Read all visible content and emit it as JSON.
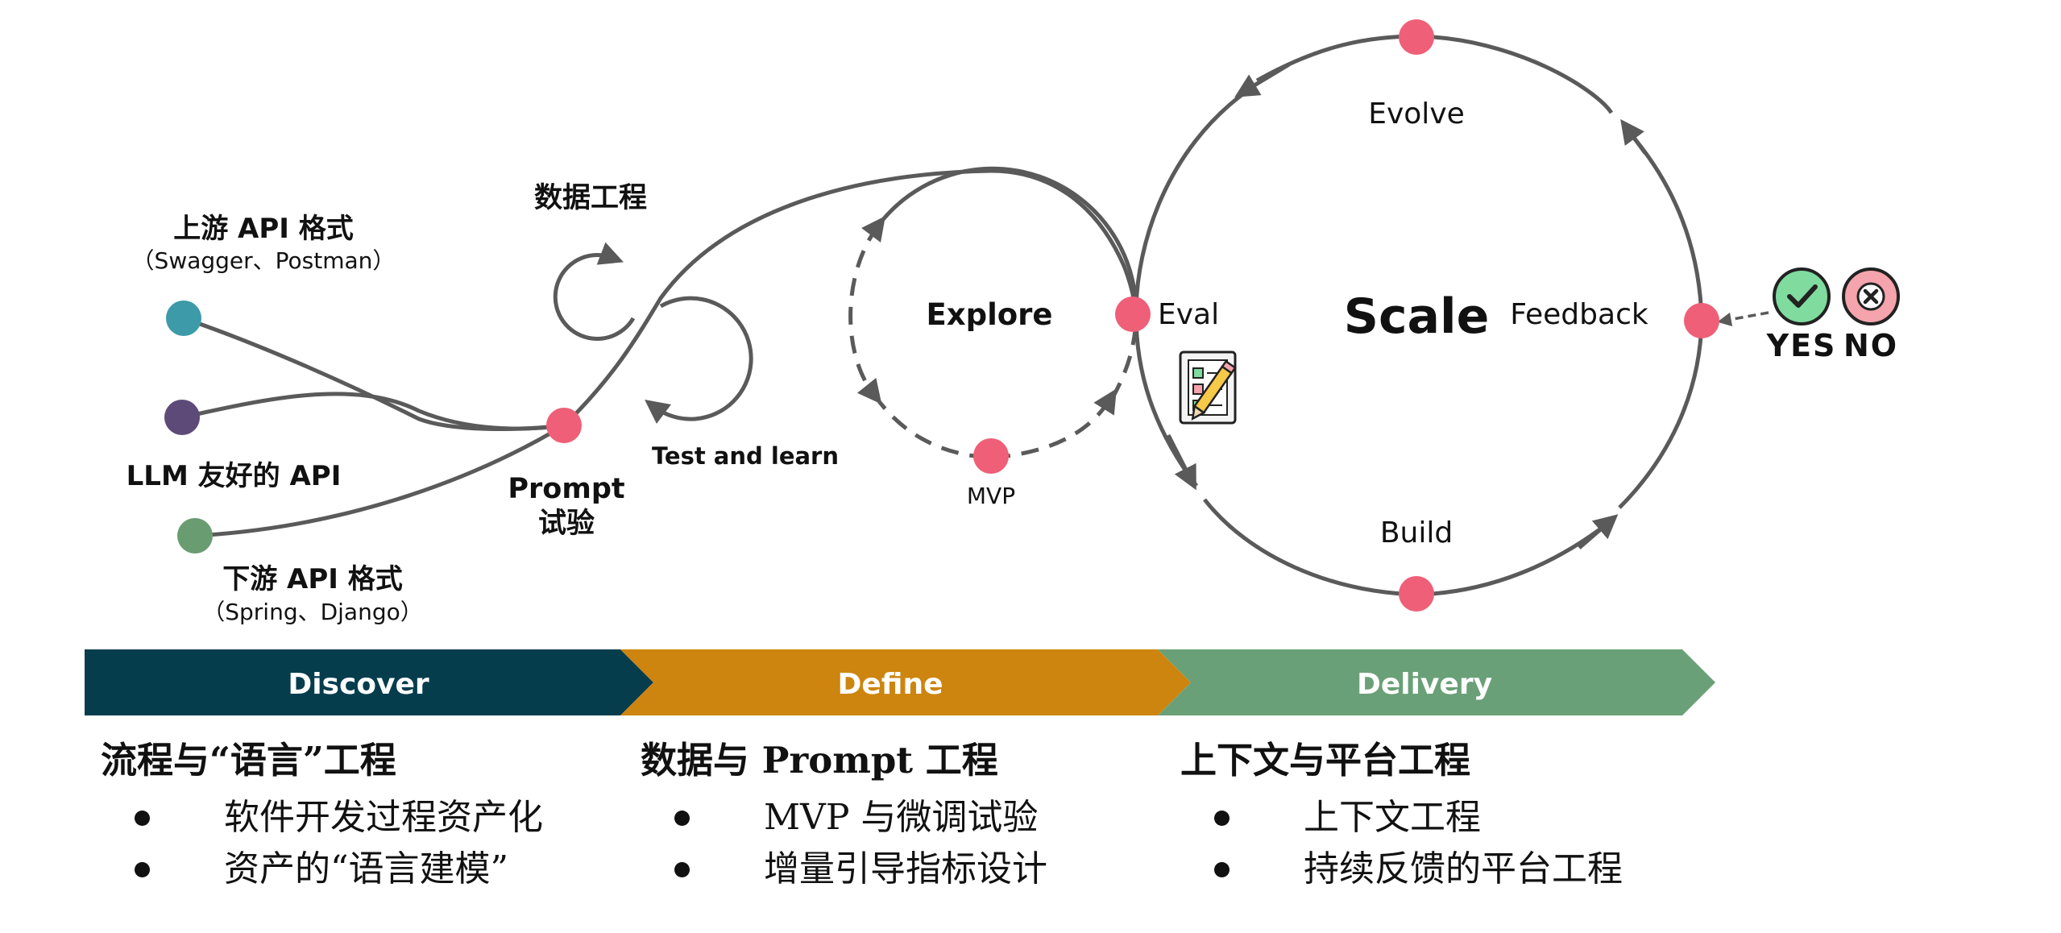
{
  "colors": {
    "node": "#ef5f78",
    "line": "#5a5a5a",
    "upstream_dot": "#3d9aa8",
    "llm_dot": "#5d4a78",
    "downstream_dot": "#6a9c72",
    "discover": "#053d4d",
    "define": "#cd850f",
    "delivery": "#6aa077",
    "yes_badge": "#7fdb9e",
    "no_badge": "#f5a3ac"
  },
  "labels": {
    "upstream_title": "上游 API 格式",
    "upstream_sub": "（Swagger、Postman）",
    "llm_api": "LLM 友好的 API",
    "downstream_title": "下游 API 格式",
    "downstream_sub": "（Spring、Django）",
    "data_eng": "数据工程",
    "prompt_line1": "Prompt",
    "prompt_line2": "试验",
    "test_learn": "Test and learn",
    "explore": "Explore",
    "mvp": "MVP",
    "eval": "Eval",
    "scale": "Scale",
    "evolve": "Evolve",
    "build": "Build",
    "feedback": "Feedback",
    "yes": "YES",
    "no": "NO"
  },
  "phases": [
    {
      "label": "Discover"
    },
    {
      "label": "Define"
    },
    {
      "label": "Delivery"
    }
  ],
  "sections": [
    {
      "title": "流程与“语言”工程",
      "items": [
        "软件开发过程资产化",
        "资产的“语言建模”"
      ]
    },
    {
      "title": "数据与 Prompt 工程",
      "items": [
        "MVP 与微调试验",
        "增量引导指标设计"
      ]
    },
    {
      "title": "上下文与平台工程",
      "items": [
        "上下文工程",
        "持续反馈的平台工程"
      ]
    }
  ],
  "icons": [
    "eval-checklist-icon",
    "check-icon",
    "cross-icon"
  ]
}
